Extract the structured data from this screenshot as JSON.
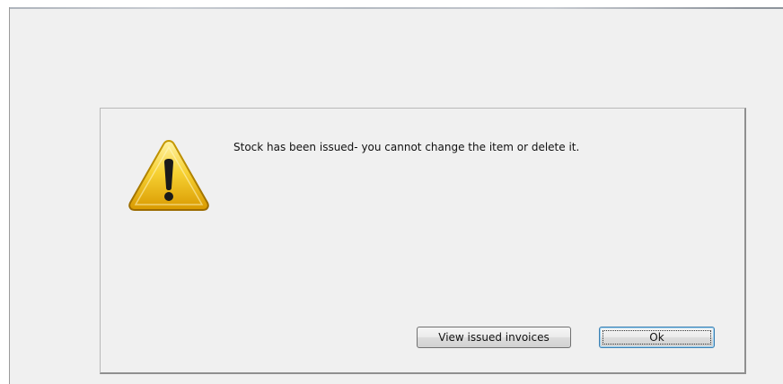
{
  "dialog": {
    "message": "Stock has been issued- you cannot change the item or delete it.",
    "icon": "warning-icon",
    "buttons": {
      "view_issued_invoices": "View issued invoices",
      "ok": "Ok"
    }
  },
  "colors": {
    "background": "#f0f0f0",
    "warning_yellow": "#f2c200",
    "focus_border": "#3c7fb1"
  }
}
